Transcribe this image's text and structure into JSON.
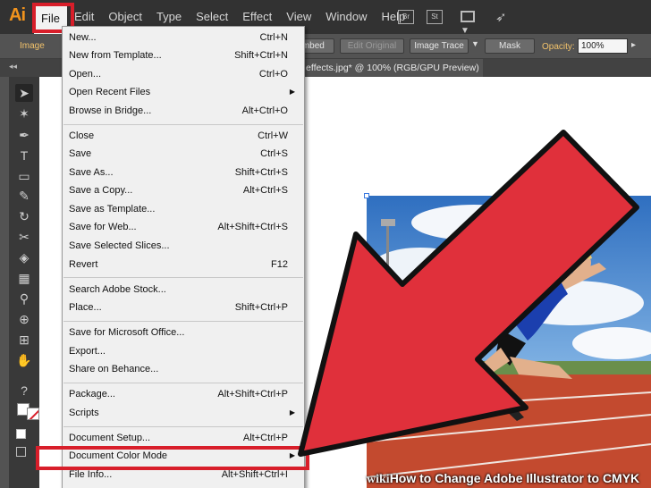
{
  "app": {
    "logo": "Ai"
  },
  "menubar": {
    "items": [
      "File",
      "Edit",
      "Object",
      "Type",
      "Select",
      "Effect",
      "View",
      "Window",
      "Help"
    ],
    "bridge_btn": "Br",
    "stock_btn": "St",
    "workspace_arrow": "▼"
  },
  "controlbar": {
    "image_label": "Image",
    "embed_btn": "Embed",
    "edit_original_btn": "Edit Original",
    "image_trace_btn": "Image Trace",
    "mask_btn": "Mask",
    "opacity_label": "Opacity:",
    "opacity_value": "100%"
  },
  "tabstrip": {
    "document_tab": "effects.jpg* @ 100% (RGB/GPU Preview)"
  },
  "file_menu": {
    "items": [
      {
        "label": "New...",
        "shortcut": "Ctrl+N"
      },
      {
        "label": "New from Template...",
        "shortcut": "Shift+Ctrl+N"
      },
      {
        "label": "Open...",
        "shortcut": "Ctrl+O"
      },
      {
        "label": "Open Recent Files",
        "shortcut": "",
        "submenu": "▶"
      },
      {
        "label": "Browse in Bridge...",
        "shortcut": "Alt+Ctrl+O"
      },
      {
        "label": "Close",
        "shortcut": "Ctrl+W"
      },
      {
        "label": "Save",
        "shortcut": "Ctrl+S"
      },
      {
        "label": "Save As...",
        "shortcut": "Shift+Ctrl+S"
      },
      {
        "label": "Save a Copy...",
        "shortcut": "Alt+Ctrl+S"
      },
      {
        "label": "Save as Template...",
        "shortcut": ""
      },
      {
        "label": "Save for Web...",
        "shortcut": "Alt+Shift+Ctrl+S"
      },
      {
        "label": "Save Selected Slices...",
        "shortcut": ""
      },
      {
        "label": "Revert",
        "shortcut": "F12"
      },
      {
        "label": "Search Adobe Stock...",
        "shortcut": ""
      },
      {
        "label": "Place...",
        "shortcut": "Shift+Ctrl+P"
      },
      {
        "label": "Save for Microsoft Office...",
        "shortcut": ""
      },
      {
        "label": "Export...",
        "shortcut": ""
      },
      {
        "label": "Share on Behance...",
        "shortcut": ""
      },
      {
        "label": "Package...",
        "shortcut": "Alt+Shift+Ctrl+P"
      },
      {
        "label": "Scripts",
        "shortcut": "",
        "submenu": "▶"
      },
      {
        "label": "Document Setup...",
        "shortcut": "Alt+Ctrl+P"
      },
      {
        "label": "Document Color Mode",
        "shortcut": "",
        "submenu": "▶"
      },
      {
        "label": "File Info...",
        "shortcut": "Alt+Shift+Ctrl+I"
      }
    ]
  },
  "watermark": {
    "prefix": "wiki",
    "text": "How to Change Adobe Illustrator to CMYK"
  },
  "colors": {
    "highlight_red": "#d81e2a",
    "arrow_red": "#e0303b",
    "illustrator_orange": "#f1931d"
  }
}
